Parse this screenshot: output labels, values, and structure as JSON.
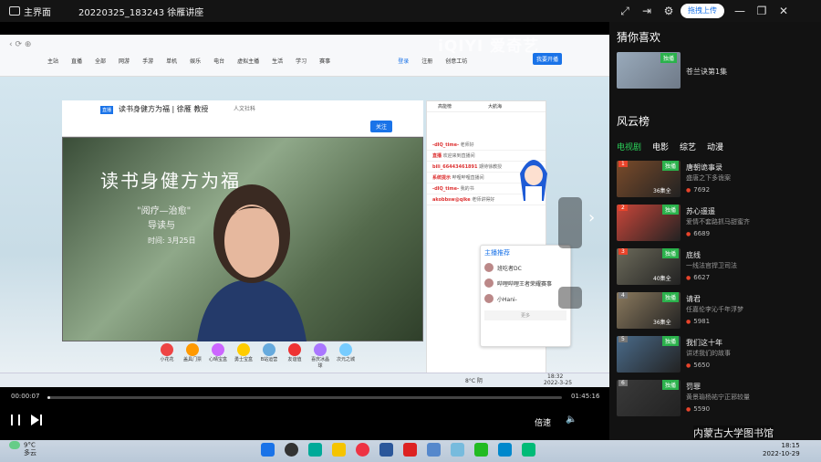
{
  "topbar": {
    "home": "主界面",
    "title": "20220325_183243 徐雁讲座"
  },
  "tools": {
    "upload": "拖拽上传"
  },
  "watermark": "iQIYI 爱奇艺",
  "browser": {
    "nav": [
      "主站",
      "直播",
      "全部",
      "网游",
      "手游",
      "单机",
      "娱乐",
      "电台",
      "虚拟主播",
      "生活",
      "学习",
      "赛事"
    ],
    "login": "登录",
    "signup": "注册",
    "creator": "创意工坊",
    "start": "我要开播"
  },
  "stream": {
    "tag": "直播",
    "name": "读书身健方为福 | 徐雁 教授",
    "category": "人文社科",
    "follow": "关注"
  },
  "poster": {
    "line1": "读书身健方为福",
    "line2": "\"阅疗—治愈\"",
    "line3": "导读与",
    "line4": "时间: 3月25日"
  },
  "chat": {
    "tabs": [
      "高能榜",
      "大航海"
    ],
    "messages": [
      {
        "user": "-dIQ_time-",
        "text": "老师好"
      },
      {
        "user": "直播",
        "text": "欢迎来到直播间"
      },
      {
        "user": "bili_66443461891",
        "text": "期待徐教授"
      },
      {
        "user": "系统提示",
        "text": "哔哩哔哩直播间"
      },
      {
        "user": "-dIQ_time-",
        "text": "我的书"
      },
      {
        "user": "akobbsw@qike",
        "text": "老师讲得好"
      }
    ]
  },
  "recommend": {
    "title": "主播推荐",
    "items": [
      "班吃者DC",
      "哔哩哔哩王者荣耀赛事",
      "小Hani-"
    ],
    "more": "更多"
  },
  "gifts": [
    "小花花",
    "盖具门票",
    "心晴宝盒",
    "勇士宝盒",
    "B站运营",
    "友谊值",
    "喜庆冰晶球",
    "次元之城"
  ],
  "player": {
    "start": "00:00:07",
    "end": "01:45:16",
    "progress": 0.001,
    "speed": "倍速"
  },
  "innertaskbar": {
    "temp": "8°C 阴",
    "time": "18:32",
    "date": "2022-3-25"
  },
  "sidebar": {
    "guess_title": "猜你喜欢",
    "guess_item": "苍兰诀第1集",
    "guess_badge": "独播",
    "rank_title": "风云榜",
    "tabs": [
      "电视剧",
      "电影",
      "综艺",
      "动漫"
    ],
    "items": [
      {
        "rank": "1",
        "name": "唐朝诡事录",
        "desc": "盛唐之下多诡案",
        "hot": "7692",
        "eps": "36集全",
        "color": "#7a4b2a"
      },
      {
        "rank": "2",
        "name": "苏心遥遥",
        "desc": "爱情不套路抓马甜蜜齐",
        "hot": "6689",
        "eps": "",
        "color": "#c9463a"
      },
      {
        "rank": "3",
        "name": "底线",
        "desc": "一线法官捍卫司法",
        "hot": "6627",
        "eps": "40集全",
        "color": "#6c6a5a"
      },
      {
        "rank": "4",
        "name": "请君",
        "desc": "任嘉伦李沁千年浮梦",
        "hot": "5981",
        "eps": "36集全",
        "color": "#8b7a5e"
      },
      {
        "rank": "5",
        "name": "我们这十年",
        "desc": "讲述我们的故事",
        "hot": "5650",
        "eps": "",
        "color": "#4a6b8a"
      },
      {
        "rank": "6",
        "name": "罚罪",
        "desc": "黄景瑜杨祐宁正邪较量",
        "hot": "5590",
        "eps": "",
        "color": "#3a3a3a"
      }
    ],
    "overlay": "内蒙古大学图书馆"
  },
  "weather": {
    "temp": "9°C",
    "cond": "多云"
  },
  "clock": {
    "time": "18:15",
    "date": "2022-10-29"
  }
}
